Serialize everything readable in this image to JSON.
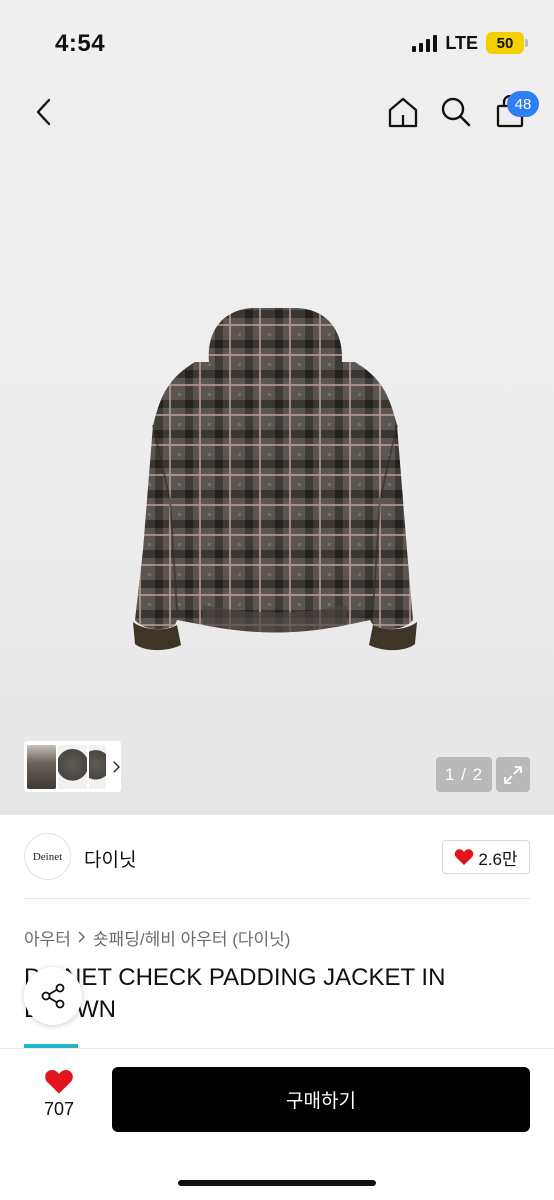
{
  "status_bar": {
    "time": "4:54",
    "network": "LTE",
    "battery": "50"
  },
  "nav": {
    "icons": [
      "back-chevron-icon",
      "home-icon",
      "search-icon",
      "shopping-bag-icon"
    ],
    "cart_count": "48"
  },
  "gallery": {
    "pager": "1 / 2",
    "thumbnail_icons": [
      "thumbnail-model",
      "thumbnail-jacket-front",
      "thumbnail-jacket-back"
    ],
    "colors": {
      "jacket_base": "#5b5651",
      "jacket_dark": "#2e2b28",
      "jacket_check": "#b89a93",
      "rib_cuff": "#3d3526"
    }
  },
  "brand": {
    "logo_text": "Deinet",
    "name": "다이닛",
    "likes": "2.6만"
  },
  "breadcrumb": {
    "items": [
      "아우터",
      "숏패딩/헤비 아우터 (다이닛)"
    ]
  },
  "product": {
    "title": "DEINET CHECK PADDING JACKET IN BROWN"
  },
  "bottom_bar": {
    "wish_count": "707",
    "buy_label": "구매하기",
    "colors": {
      "heart": "#e3141e",
      "buy_bg": "#000000",
      "accent": "#1fb6c9",
      "badge": "#2d7ef7"
    }
  }
}
